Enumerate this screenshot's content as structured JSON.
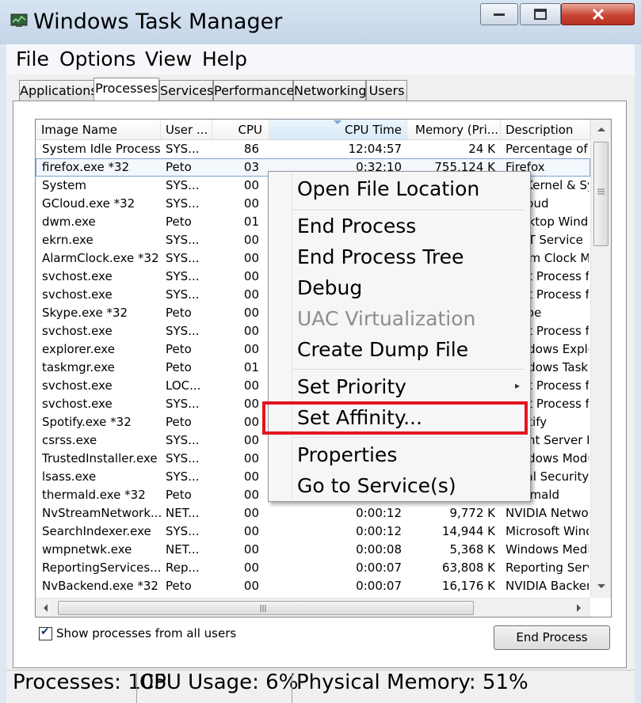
{
  "window": {
    "title": "Windows Task Manager",
    "minimize_glyph": "▁",
    "maximize_glyph": "▢",
    "close_glyph": "✕"
  },
  "menu": {
    "file": "File",
    "options": "Options",
    "view": "View",
    "help": "Help"
  },
  "tabs": [
    "Applications",
    "Processes",
    "Services",
    "Performance",
    "Networking",
    "Users"
  ],
  "active_tab": "Processes",
  "columns": [
    "Image Name",
    "User ...",
    "CPU",
    "CPU Time",
    "Memory (Pri...",
    "Description"
  ],
  "sorted_column": "CPU Time",
  "rows": [
    {
      "name": "System Idle Process",
      "user": "SYS...",
      "cpu": "86",
      "time": "12:04:57",
      "mem": "24 K",
      "desc": "Percentage of time the processor is idle"
    },
    {
      "name": "firefox.exe *32",
      "user": "Peto",
      "cpu": "03",
      "time": "0:32:10",
      "mem": "755,124 K",
      "desc": "Firefox"
    },
    {
      "name": "System",
      "user": "SYS...",
      "cpu": "00",
      "time": "",
      "mem": "",
      "desc": "NT Kernel & System"
    },
    {
      "name": "GCloud.exe *32",
      "user": "SYS...",
      "cpu": "00",
      "time": "",
      "mem": "",
      "desc": "GCloud"
    },
    {
      "name": "dwm.exe",
      "user": "Peto",
      "cpu": "01",
      "time": "",
      "mem": "",
      "desc": "Desktop Window Manager"
    },
    {
      "name": "ekrn.exe",
      "user": "SYS...",
      "cpu": "00",
      "time": "",
      "mem": "",
      "desc": "ESET Service"
    },
    {
      "name": "AlarmClock.exe *32",
      "user": "SYS...",
      "cpu": "00",
      "time": "",
      "mem": "",
      "desc": "Alarm Clock Management"
    },
    {
      "name": "svchost.exe",
      "user": "SYS...",
      "cpu": "00",
      "time": "",
      "mem": "",
      "desc": "Host Process for Windows Services"
    },
    {
      "name": "svchost.exe",
      "user": "SYS...",
      "cpu": "00",
      "time": "",
      "mem": "",
      "desc": "Host Process for Windows Services"
    },
    {
      "name": "Skype.exe *32",
      "user": "Peto",
      "cpu": "00",
      "time": "",
      "mem": "",
      "desc": "Skype"
    },
    {
      "name": "svchost.exe",
      "user": "SYS...",
      "cpu": "00",
      "time": "",
      "mem": "",
      "desc": "Host Process for Windows Services"
    },
    {
      "name": "explorer.exe",
      "user": "Peto",
      "cpu": "00",
      "time": "",
      "mem": "",
      "desc": "Windows Explorer"
    },
    {
      "name": "taskmgr.exe",
      "user": "Peto",
      "cpu": "01",
      "time": "",
      "mem": "",
      "desc": "Windows Task Manager"
    },
    {
      "name": "svchost.exe",
      "user": "LOC...",
      "cpu": "00",
      "time": "",
      "mem": "",
      "desc": "Host Process for Windows Services"
    },
    {
      "name": "svchost.exe",
      "user": "SYS...",
      "cpu": "00",
      "time": "",
      "mem": "",
      "desc": "Host Process for Windows Services"
    },
    {
      "name": "Spotify.exe *32",
      "user": "Peto",
      "cpu": "00",
      "time": "",
      "mem": "",
      "desc": "Spotify"
    },
    {
      "name": "csrss.exe",
      "user": "SYS...",
      "cpu": "00",
      "time": "",
      "mem": "",
      "desc": "Client Server Runtime Process"
    },
    {
      "name": "TrustedInstaller.exe",
      "user": "SYS...",
      "cpu": "00",
      "time": "",
      "mem": "",
      "desc": "Windows Modules Installer"
    },
    {
      "name": "lsass.exe",
      "user": "SYS...",
      "cpu": "00",
      "time": "",
      "mem": "",
      "desc": "Local Security Authority Process"
    },
    {
      "name": "thermald.exe *32",
      "user": "Peto",
      "cpu": "00",
      "time": "",
      "mem": "",
      "desc": "thermald"
    },
    {
      "name": "NvStreamNetwork...",
      "user": "NET...",
      "cpu": "00",
      "time": "0:00:12",
      "mem": "9,772 K",
      "desc": "NVIDIA Network Service"
    },
    {
      "name": "SearchIndexer.exe",
      "user": "SYS...",
      "cpu": "00",
      "time": "0:00:12",
      "mem": "14,944 K",
      "desc": "Microsoft Windows Search Indexer"
    },
    {
      "name": "wmpnetwk.exe",
      "user": "NET...",
      "cpu": "00",
      "time": "0:00:08",
      "mem": "5,368 K",
      "desc": "Windows Media Player Network Sharing Service"
    },
    {
      "name": "ReportingServices...",
      "user": "Rep...",
      "cpu": "00",
      "time": "0:00:07",
      "mem": "63,808 K",
      "desc": "Reporting Services Service"
    },
    {
      "name": "NvBackend.exe *32",
      "user": "Peto",
      "cpu": "00",
      "time": "0:00:07",
      "mem": "16,176 K",
      "desc": "NVIDIA Backend"
    }
  ],
  "selected_row": 1,
  "context_menu": {
    "open_file_location": "Open File Location",
    "end_process": "End Process",
    "end_process_tree": "End Process Tree",
    "debug": "Debug",
    "uac_virtualization": "UAC Virtualization",
    "create_dump_file": "Create Dump File",
    "set_priority": "Set Priority",
    "submenu_arrow": "▸",
    "set_affinity": "Set Affinity...",
    "properties": "Properties",
    "go_to_services": "Go to Service(s)"
  },
  "checkbox": {
    "label": "Show processes from all users",
    "checked": true,
    "check_glyph": "✔"
  },
  "end_process_button": "End Process",
  "status": {
    "processes": "Processes: 105",
    "cpu_usage": "CPU Usage: 6%",
    "physical_memory": "Physical Memory: 51%"
  },
  "colors": {
    "highlight_border": "#e3141f",
    "selection_border": "#7da2ce",
    "disabled_text": "#8d8d8d"
  }
}
